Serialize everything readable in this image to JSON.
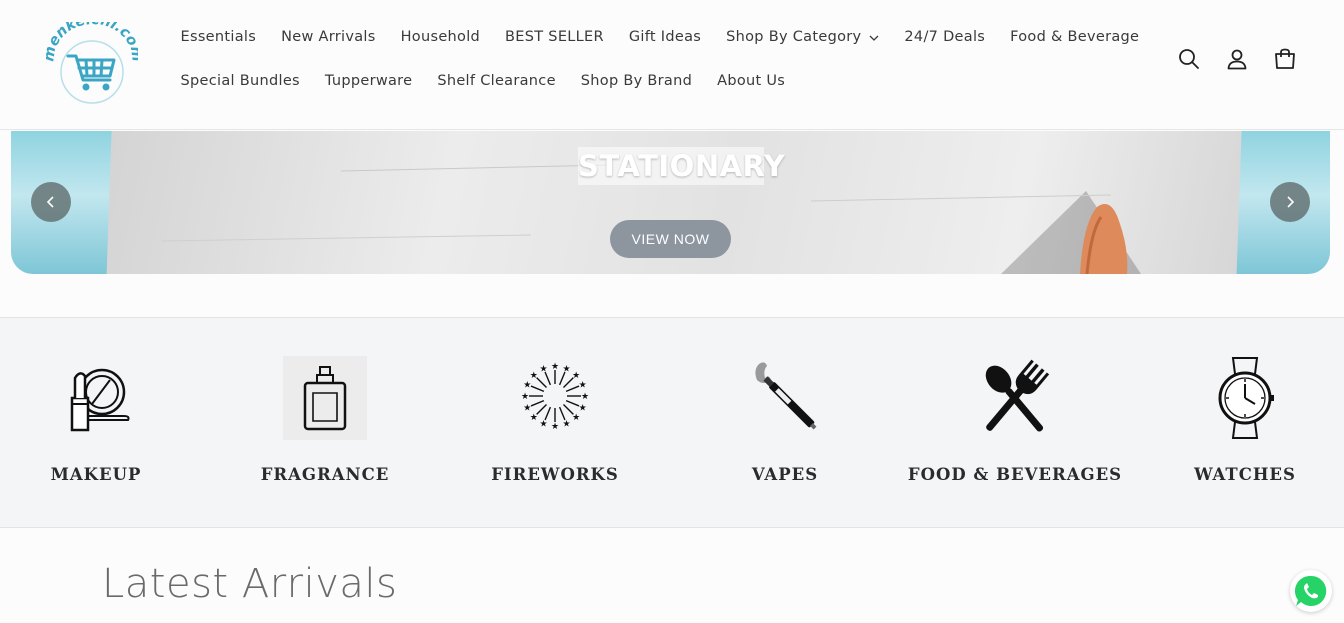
{
  "logo": {
    "text": "menkelchi.com",
    "alt": "menkelchi.com logo",
    "color": "#3aa6c4"
  },
  "nav": {
    "row1": [
      {
        "label": "Essentials"
      },
      {
        "label": "New Arrivals"
      },
      {
        "label": "Household"
      },
      {
        "label": "BEST SELLER"
      },
      {
        "label": "Gift Ideas"
      },
      {
        "label": "Shop By Category",
        "dropdown": true
      },
      {
        "label": "24/7 Deals"
      },
      {
        "label": "Food & Beverage"
      }
    ],
    "row2": [
      {
        "label": "Special Bundles"
      },
      {
        "label": "Tupperware"
      },
      {
        "label": "Shelf Clearance"
      },
      {
        "label": "Shop By Brand"
      },
      {
        "label": "About Us"
      }
    ]
  },
  "header_icons": [
    "search-icon",
    "account-icon",
    "cart-icon"
  ],
  "banner": {
    "title": "STATIONARY",
    "button": "VIEW NOW",
    "prev_icon": "chevron-left-icon",
    "next_icon": "chevron-right-icon"
  },
  "categories": [
    {
      "label": "MAKEUP",
      "icon": "makeup-icon"
    },
    {
      "label": "FRAGRANCE",
      "icon": "perfume-bottle-icon"
    },
    {
      "label": "FIREWORKS",
      "icon": "fireworks-icon"
    },
    {
      "label": "VAPES",
      "icon": "vape-icon"
    },
    {
      "label": "FOOD & BEVERAGES",
      "icon": "spoon-fork-icon"
    },
    {
      "label": "WATCHES",
      "icon": "watch-icon"
    }
  ],
  "section_title": "Latest Arrivals",
  "chat_icon": "whatsapp-icon",
  "colors": {
    "accent": "#3aa6c4",
    "button": "#8d959e",
    "whatsapp": "#25d366"
  }
}
